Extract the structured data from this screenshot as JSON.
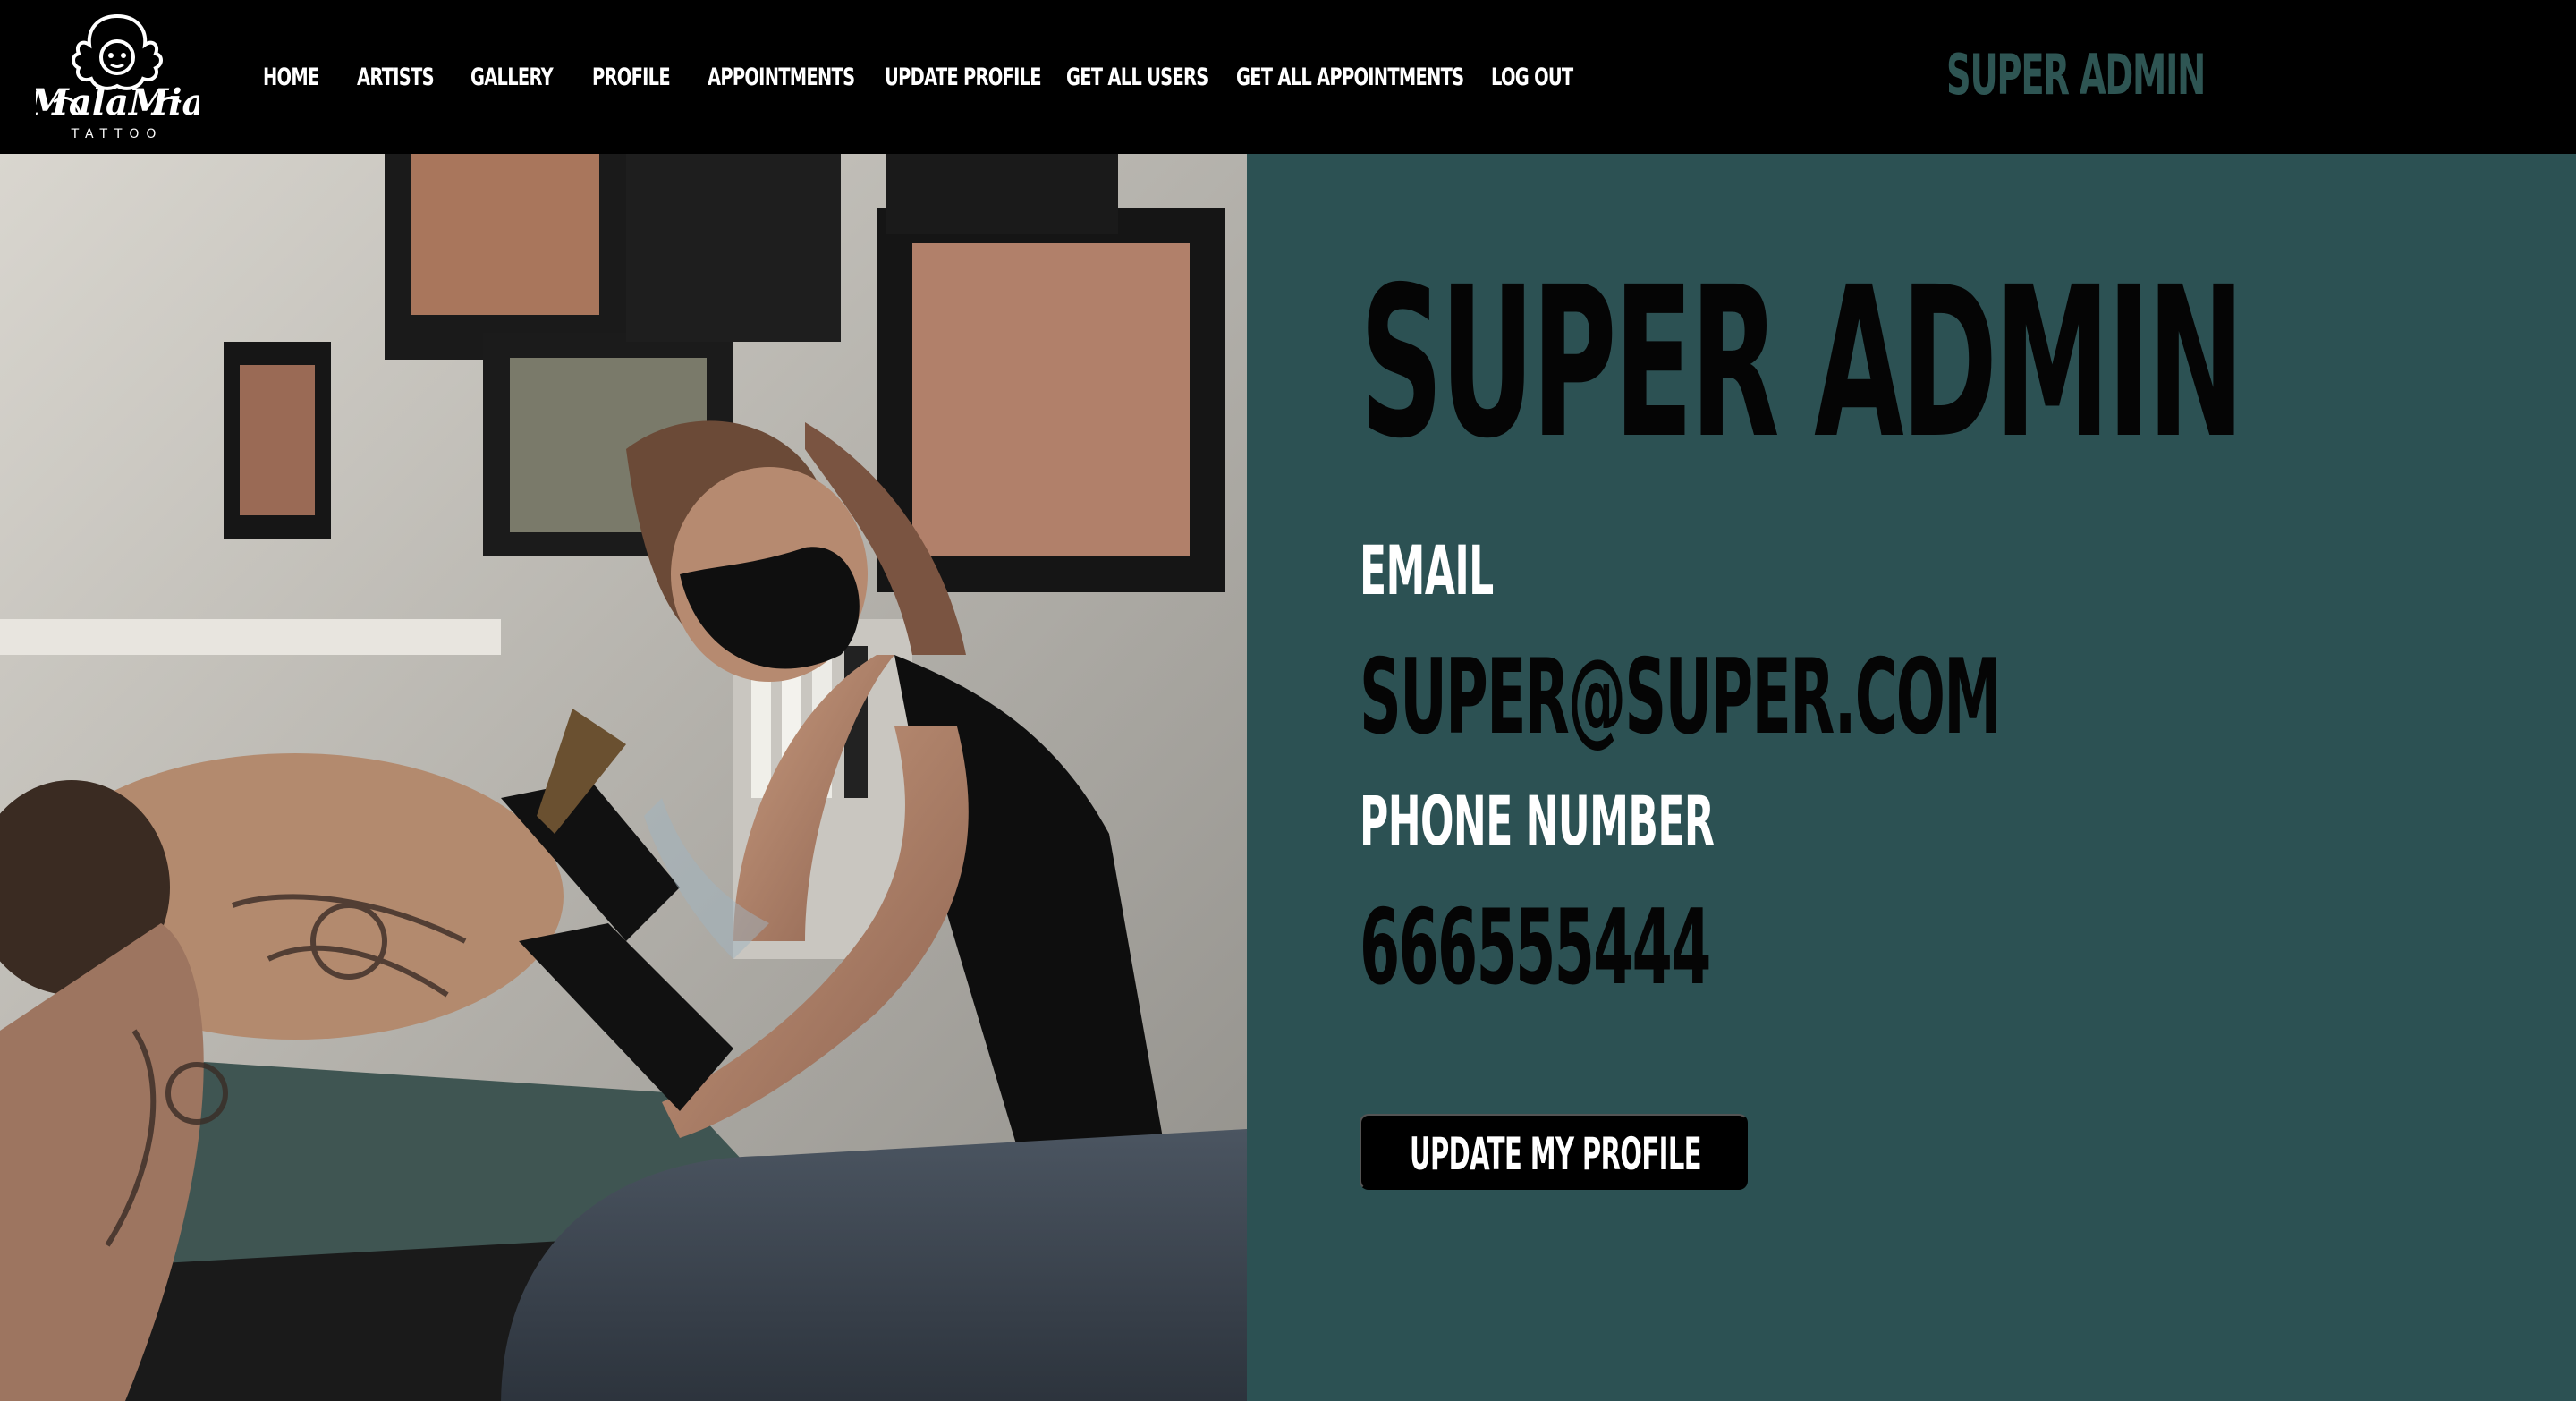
{
  "nav": {
    "items": [
      "HOME",
      "ARTISTS",
      "GALLERY",
      "PROFILE",
      "APPOINTMENTS",
      "UPDATE PROFILE",
      "GET ALL USERS",
      "GET ALL APPOINTMENTS",
      "LOG OUT"
    ],
    "brand_text": "SUPER ADMIN",
    "logo_text": "MalaMia",
    "logo_sub": "TATTOO"
  },
  "profile": {
    "name": "SUPER ADMIN",
    "email_label": "EMAIL",
    "email": "SUPER@SUPER.COM",
    "phone_label": "PHONE NUMBER",
    "phone": "666555444",
    "update_button": "UPDATE MY PROFILE"
  },
  "colors": {
    "nav_bg": "#000000",
    "panel_bg": "#2c5153",
    "brand_accent": "#2e5553",
    "heading": "#050505",
    "label": "#ffffff"
  },
  "icons": [
    "malamia-logo",
    "tattoo-artist-photo"
  ]
}
